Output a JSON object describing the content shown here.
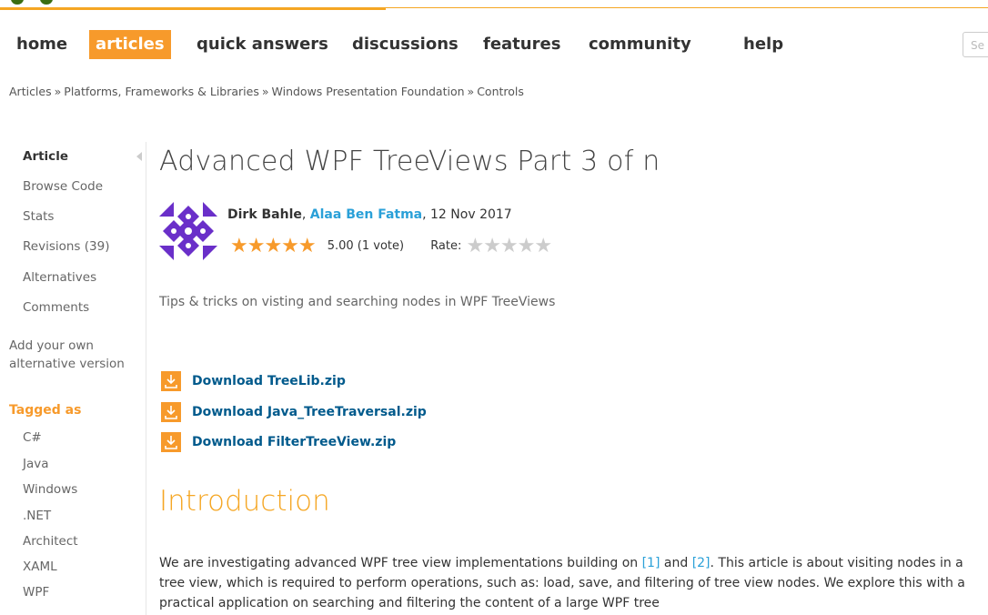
{
  "nav": {
    "items": [
      "home",
      "articles",
      "quick answers",
      "discussions",
      "features",
      "community",
      "help"
    ],
    "active": "articles",
    "search_placeholder": "Se"
  },
  "breadcrumb": [
    "Articles",
    "Platforms, Frameworks & Libraries",
    "Windows Presentation Foundation",
    "Controls"
  ],
  "breadcrumb_sep": "»",
  "sidebar": {
    "items": [
      "Article",
      "Browse Code",
      "Stats",
      "Revisions (39)",
      "Alternatives",
      "Comments"
    ],
    "add_alternative": "Add your own alternative version",
    "tagged_as": "Tagged as",
    "tags": [
      "C#",
      "Java",
      "Windows",
      ".NET",
      "Architect",
      "XAML",
      "WPF"
    ]
  },
  "article": {
    "title": "Advanced WPF TreeViews Part 3 of n",
    "author1": "Dirk Bahle",
    "author2": "Alaa Ben Fatma",
    "date": ", 12 Nov 2017",
    "comma": ", ",
    "stars": "★★★★★",
    "score": "5.00 (1 vote)",
    "rate_label": "Rate:",
    "summary": "Tips & tricks on visting and searching nodes in WPF TreeViews",
    "downloads": [
      "Download TreeLib.zip",
      "Download Java_TreeTraversal.zip",
      "Download FilterTreeView.zip"
    ],
    "intro_heading": "Introduction",
    "intro_pre": "We are investigating advanced WPF tree view implementations building on ",
    "ref1": "[1]",
    "intro_and": " and ",
    "ref2": "[2]",
    "intro_post": ". This article is about visiting nodes in a tree view, which is required to perform operations, such as: load, save, and filtering of tree view nodes. We explore this with a practical application on searching and filtering the content of a large WPF tree"
  },
  "colors": {
    "accent": "#f79a2b",
    "link": "#2aa0d8",
    "download_link": "#005a8c",
    "logo": "#3a6e12"
  },
  "icons": [
    "download-icon",
    "avatar-identicon",
    "collapse-arrow-icon"
  ]
}
